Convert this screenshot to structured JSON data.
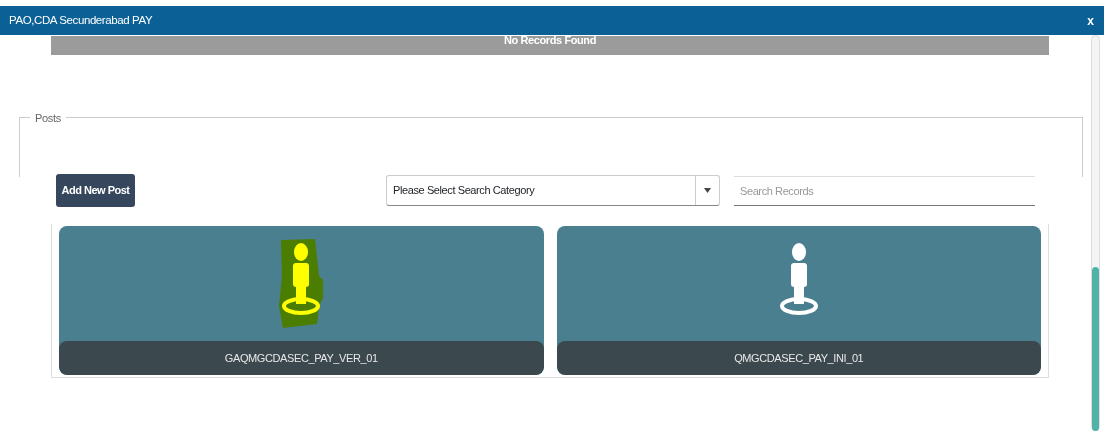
{
  "window": {
    "title": "PAO,CDA Secunderabad PAY",
    "close": "x"
  },
  "records_bar": {
    "text": "No Records Found"
  },
  "posts": {
    "legend": "Posts",
    "add_button": "Add New Post",
    "category_select": {
      "value": "Please Select Search Category"
    },
    "search": {
      "placeholder": "Search Records"
    },
    "items": [
      {
        "label": "GAQMGCDASEC_PAY_VER_01",
        "selected": true
      },
      {
        "label": "QMGCDASEC_PAY_INI_01",
        "selected": false
      }
    ]
  }
}
